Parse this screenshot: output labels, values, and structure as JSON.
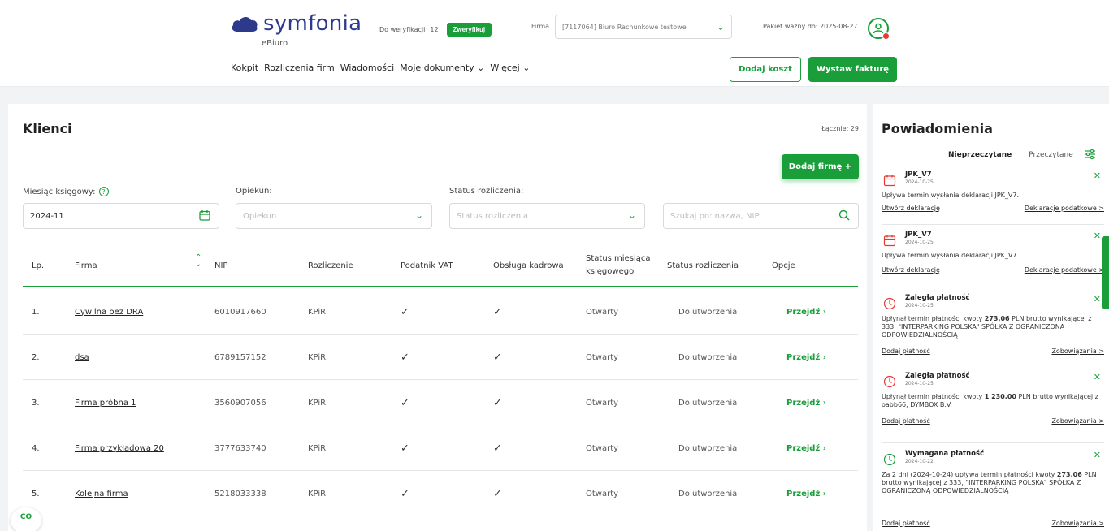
{
  "header": {
    "logo_text": "symfonia",
    "logo_sub": "eBiuro",
    "verification_label": "Do weryfikacji",
    "verification_count": "12",
    "verify_button": "Zweryfikuj",
    "firma_label": "Firma",
    "firma_value": "[7117064] Biuro Rachunkowe testowe",
    "package_valid": "Pakiet ważny do: 2025-08-27",
    "nav": [
      "Kokpit",
      "Rozliczenia firm",
      "Wiadomości",
      "Moje dokumenty ⌄",
      "Więcej ⌄"
    ],
    "add_cost_button": "Dodaj koszt",
    "invoice_button": "Wystaw fakturę"
  },
  "clients": {
    "title": "Klienci",
    "total": "Łącznie: 29",
    "add_firm_button": "Dodaj firmę +",
    "filters": {
      "month_label": "Miesiąc księgowy:",
      "month_value": "2024-11",
      "caretaker_label": "Opiekun:",
      "caretaker_placeholder": "Opiekun",
      "status_label": "Status rozliczenia:",
      "status_placeholder": "Status rozliczenia",
      "search_placeholder": "Szukaj po: nazwa, NIP"
    },
    "columns": [
      "Lp.",
      "Firma",
      "NIP",
      "Rozliczenie",
      "Podatnik VAT",
      "Obsługa kadrowa",
      "Status miesiąca księgowego",
      "Status rozliczenia",
      "Opcje"
    ],
    "rows": [
      {
        "lp": "1.",
        "firma": "Cywilna bez DRA",
        "nip": "6010917660",
        "rozliczenie": "KPiR",
        "status_miesiaca": "Otwarty",
        "status_rozliczenia": "Do utworzenia",
        "action": "Przejdź"
      },
      {
        "lp": "2.",
        "firma": "dsa",
        "nip": "6789157152",
        "rozliczenie": "KPiR",
        "status_miesiaca": "Otwarty",
        "status_rozliczenia": "Do utworzenia",
        "action": "Przejdź"
      },
      {
        "lp": "3.",
        "firma": "Firma próbna 1",
        "nip": "3560907056",
        "rozliczenie": "KPiR",
        "status_miesiaca": "Otwarty",
        "status_rozliczenia": "Do utworzenia",
        "action": "Przejdź"
      },
      {
        "lp": "4.",
        "firma": "Firma przykładowa 20",
        "nip": "3777633740",
        "rozliczenie": "KPiR",
        "status_miesiaca": "Otwarty",
        "status_rozliczenia": "Do utworzenia",
        "action": "Przejdź"
      },
      {
        "lp": "5.",
        "firma": "Kolejna firma",
        "nip": "5218033338",
        "rozliczenie": "KPiR",
        "status_miesiaca": "Otwarty",
        "status_rozliczenia": "Do utworzenia",
        "action": "Przejdź"
      }
    ]
  },
  "notifications": {
    "title": "Powiadomienia",
    "tab_unread": "Nieprzeczytane",
    "tab_read": "Przeczytane",
    "items": [
      {
        "title": "JPK_V7",
        "date": "2024-10-25",
        "text": "Upływa termin wysłania deklaracji JPK_V7.",
        "link_left": "Utwórz deklarację",
        "link_right": "Deklaracje podatkowe >"
      },
      {
        "title": "JPK_V7",
        "date": "2024-10-25",
        "text": "Upływa termin wysłania deklaracji JPK_V7.",
        "link_left": "Utwórz deklarację",
        "link_right": "Deklaracje podatkowe >"
      },
      {
        "title": "Zaległa płatność",
        "date": "2024-10-25",
        "text_pre": "Upłynął termin płatności kwoty ",
        "amount": "273,06",
        "text_post": " PLN brutto wynikającej z 333, \"INTERPARKING POLSKA\" SPÓŁKA Z OGRANICZONĄ ODPOWIEDZIALNOŚCIĄ",
        "link_left": "Dodaj płatność",
        "link_right": "Zobowiązania >"
      },
      {
        "title": "Zaległa płatność",
        "date": "2024-10-25",
        "text_pre": "Upłynął termin płatności kwoty ",
        "amount": "1 230,00",
        "text_post": " PLN brutto wynikającej z oabb66, DYMBOX B.V.",
        "link_left": "Dodaj płatność",
        "link_right": "Zobowiązania >"
      },
      {
        "title": "Wymagana płatność",
        "date": "2024-10-22",
        "text_pre": "Za 2 dni (2024-10-24) upływa termin płatności kwoty ",
        "amount": "273,06",
        "text_post": " PLN brutto wynikającej z 333, \"INTERPARKING POLSKA\" SPÓŁKA Z OGRANICZONĄ ODPOWIEDZIALNOŚCIĄ",
        "link_left": "Dodaj płatność",
        "link_right": "Zobowiązania >"
      }
    ]
  },
  "badge": "CO",
  "colors": {
    "accent": "#1a9e3a",
    "brand": "#2d3a8c",
    "alert": "#e53935"
  }
}
